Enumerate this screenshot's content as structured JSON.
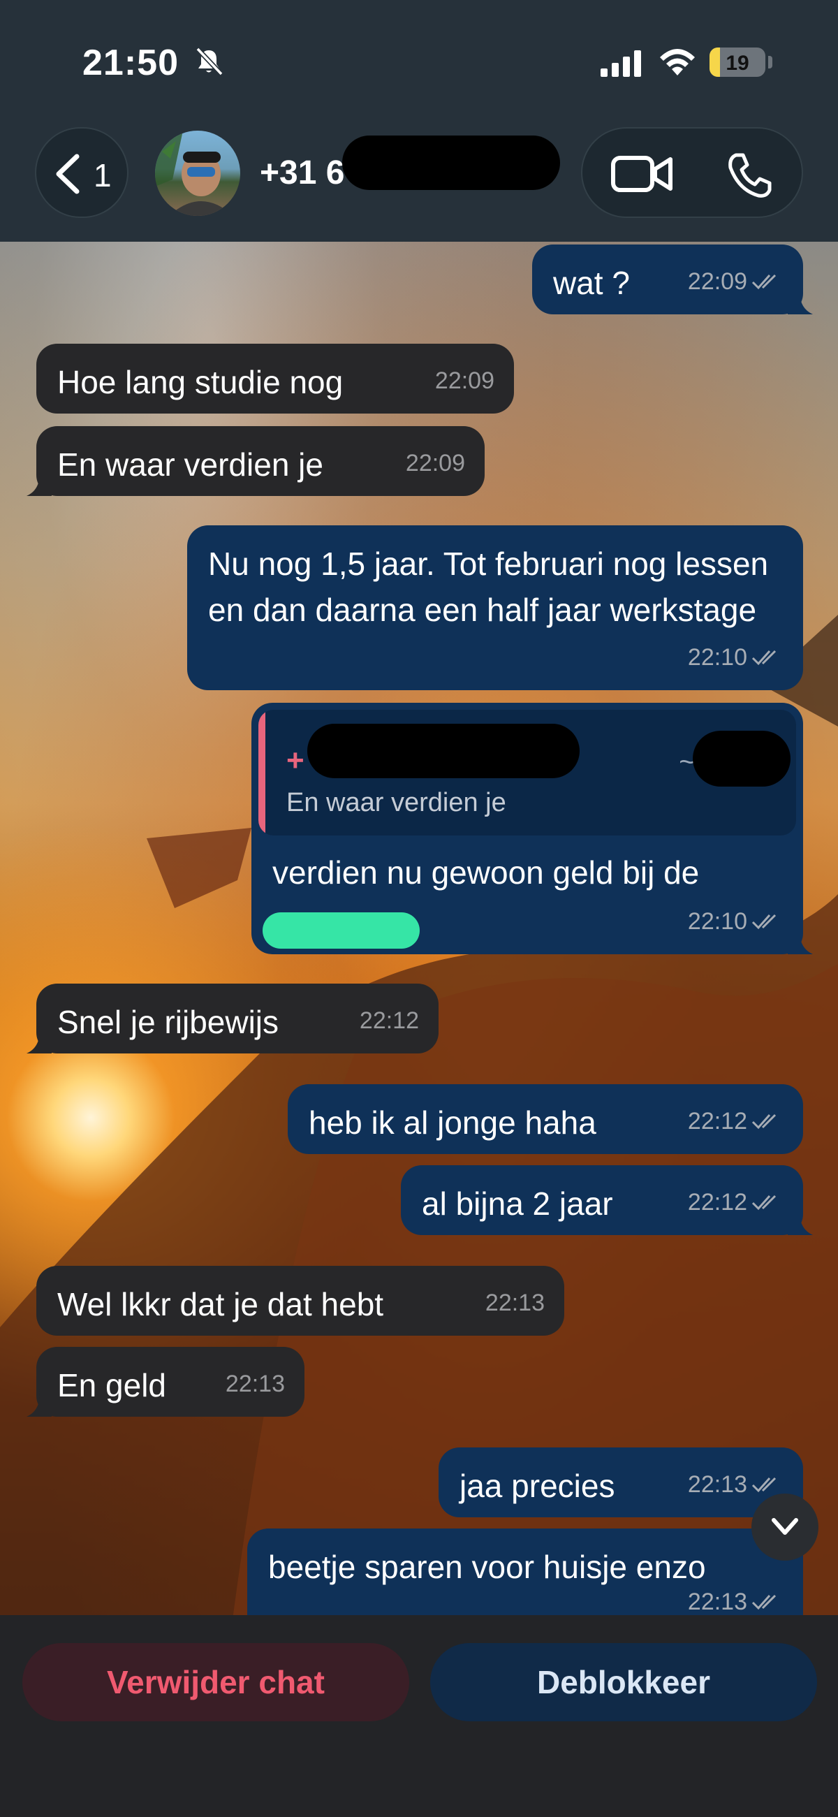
{
  "status_bar": {
    "time": "21:50",
    "battery_level": "19",
    "battery_fraction": 0.19,
    "icons": [
      "bell-slash-icon",
      "signal-icon",
      "wifi-icon",
      "battery-icon"
    ]
  },
  "header": {
    "back_count": "1",
    "contact_prefix": "+31 6",
    "icons": [
      "chevron-left-icon",
      "video-camera-icon",
      "phone-icon"
    ]
  },
  "messages": [
    {
      "dir": "out",
      "text": "wat ?",
      "time": "22:09",
      "read": true
    },
    {
      "dir": "in",
      "text": "Hoe lang studie nog",
      "time": "22:09"
    },
    {
      "dir": "in",
      "text": "En waar verdien je",
      "time": "22:09"
    },
    {
      "dir": "out",
      "text": "Nu nog 1,5 jaar. Tot februari nog lessen en dan daarna een half jaar werkstage",
      "time": "22:10",
      "read": true
    },
    {
      "dir": "out",
      "text": "verdien nu gewoon geld bij de",
      "time": "22:10",
      "read": true,
      "quote": {
        "sender_prefix": "+",
        "sender_suffix": "~F",
        "text": "En waar verdien je"
      }
    },
    {
      "dir": "in",
      "text": "Snel je rijbewijs",
      "time": "22:12"
    },
    {
      "dir": "out",
      "text": "heb ik al jonge haha",
      "time": "22:12",
      "read": true
    },
    {
      "dir": "out",
      "text": "al bijna 2 jaar",
      "time": "22:12",
      "read": true
    },
    {
      "dir": "in",
      "text": "Wel lkkr dat je dat hebt",
      "time": "22:13"
    },
    {
      "dir": "in",
      "text": "En geld",
      "time": "22:13"
    },
    {
      "dir": "out",
      "text": "jaa precies",
      "time": "22:13",
      "read": true
    },
    {
      "dir": "out",
      "text": "beetje sparen voor huisje enzo",
      "time": "22:13",
      "read": true
    }
  ],
  "actions": {
    "delete_label": "Verwijder chat",
    "unblock_label": "Deblokkeer"
  },
  "colors": {
    "incoming_bubble": "#272729",
    "outgoing_bubble": "#0f3158",
    "delete_text": "#f05a70",
    "quote_accent": "#e8657d",
    "battery_fill": "#f6d64a"
  }
}
